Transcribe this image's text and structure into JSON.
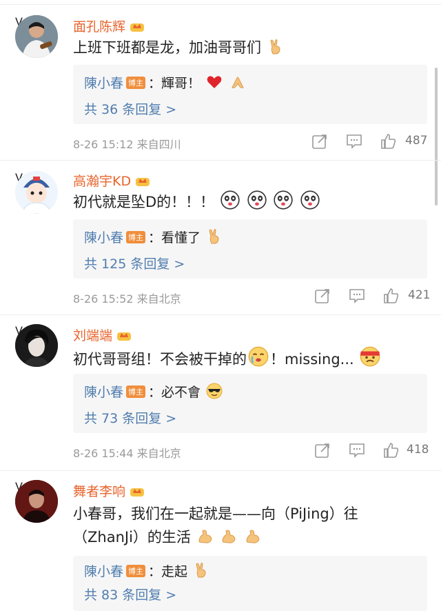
{
  "colors": {
    "username": "#e8642c",
    "reply_author": "#507daf",
    "tag_bg": "#f08e3b",
    "meta": "#9a9a9a",
    "reply_bg": "#f6f6f6"
  },
  "comments": [
    {
      "username": "面孔陈辉",
      "text": "上班下班都是龙，加油哥哥们",
      "reply": {
        "author": "陳小春",
        "tag": "博主",
        "text": "：輝哥！"
      },
      "reply_count": "共 36 条回复 >",
      "time": "8-26 15:12",
      "location": "来自四川",
      "likes": "487"
    },
    {
      "username": "高瀚宇KD",
      "text": "初代就是坠D的！！！",
      "reply": {
        "author": "陳小春",
        "tag": "博主",
        "text": "：看懂了"
      },
      "reply_count": "共 125 条回复 >",
      "time": "8-26 15:52",
      "location": "来自北京",
      "likes": "421"
    },
    {
      "username": "刘端端",
      "text_a": "初代哥哥组！不会被干掉的",
      "text_b": "！missing...",
      "reply": {
        "author": "陳小春",
        "tag": "博主",
        "text": "：必不會"
      },
      "reply_count": "共 73 条回复 >",
      "time": "8-26 15:44",
      "location": "来自北京",
      "likes": "418"
    },
    {
      "username": "舞者李响",
      "text_line1": "小春哥，我们在一起就是——向（PiJing）往",
      "text_line2": "（ZhanJi）的生活",
      "reply": {
        "author": "陳小春",
        "tag": "博主",
        "text": "：走起"
      },
      "reply_count": "共 83 条回复 >"
    }
  ],
  "icons": {
    "crown": "crown-badge-icon",
    "share": "share-icon",
    "comment": "comment-icon",
    "like": "like-icon"
  }
}
